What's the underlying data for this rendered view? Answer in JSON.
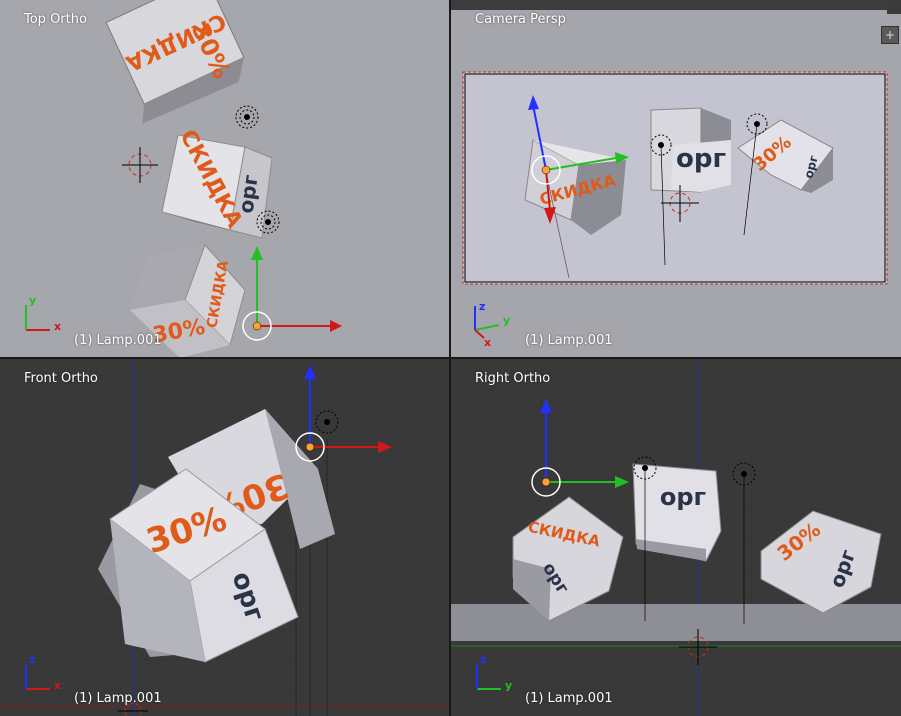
{
  "viewports": {
    "top_left": {
      "view_name": "Top Ortho",
      "object_label": "(1) Lamp.001"
    },
    "top_right": {
      "view_name": "Camera Persp",
      "object_label": "(1) Lamp.001"
    },
    "bottom_left": {
      "view_name": "Front Ortho",
      "object_label": "(1) Lamp.001"
    },
    "bottom_right": {
      "view_name": "Right Ortho",
      "object_label": "(1) Lamp.001"
    }
  },
  "cube_texts": {
    "discount": "СКИДКА",
    "percent": "30%",
    "org": "орг"
  },
  "axis_letters": {
    "x": "x",
    "y": "y",
    "z": "z"
  },
  "colors": {
    "x_axis": "#d01818",
    "y_axis": "#22c022",
    "z_axis": "#2030ff",
    "text_orange": "#e05a1a",
    "text_navy": "#2a3348",
    "selection": "#ffa030",
    "camera_frame": "#c03020"
  },
  "icons": {
    "viewport_corner": "plus-icon"
  }
}
